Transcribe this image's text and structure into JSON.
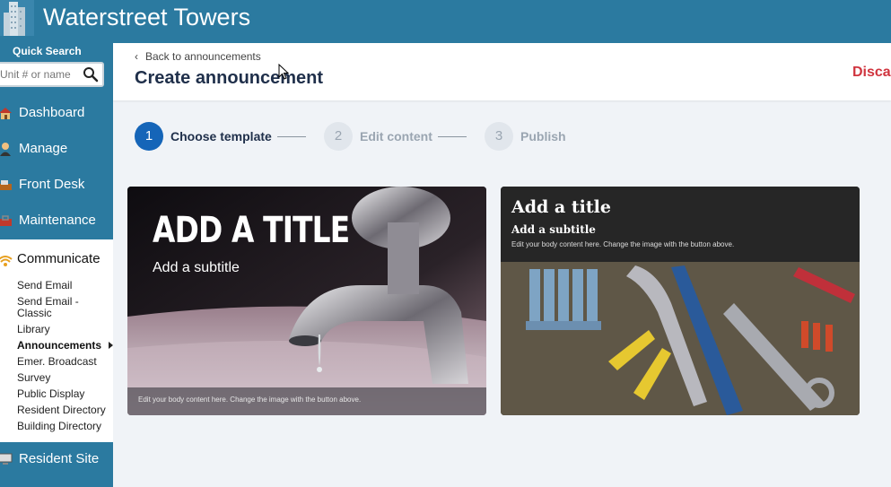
{
  "app": {
    "title": "Waterstreet Towers"
  },
  "sidebar": {
    "quick_search_label": "Quick Search",
    "quick_search_placeholder": "Unit # or name",
    "items": [
      {
        "label": "Dashboard",
        "icon": "house-icon"
      },
      {
        "label": "Manage",
        "icon": "person-icon"
      },
      {
        "label": "Front Desk",
        "icon": "desk-icon"
      },
      {
        "label": "Maintenance",
        "icon": "toolbox-icon"
      }
    ],
    "communicate": {
      "label": "Communicate",
      "icon": "wifi-icon",
      "subitems": [
        {
          "label": "Send Email"
        },
        {
          "label": "Send Email - Classic"
        },
        {
          "label": "Library"
        },
        {
          "label": "Announcements",
          "active": true
        },
        {
          "label": "Emer. Broadcast"
        },
        {
          "label": "Survey"
        },
        {
          "label": "Public Display"
        },
        {
          "label": "Resident Directory"
        },
        {
          "label": "Building Directory"
        }
      ]
    },
    "resident_site": {
      "label": "Resident Site",
      "icon": "monitor-icon"
    }
  },
  "header": {
    "back_label": "Back to announcements",
    "page_title": "Create announcement",
    "discard_label": "Discar"
  },
  "stepper": [
    {
      "num": "1",
      "label": "Choose template",
      "state": "active"
    },
    {
      "num": "2",
      "label": "Edit content",
      "state": "inactive"
    },
    {
      "num": "3",
      "label": "Publish",
      "state": "inactive"
    }
  ],
  "templates": [
    {
      "title": "ADD A TITLE",
      "subtitle": "Add a subtitle",
      "body": "Edit your body content here. Change the image with the button above.",
      "image": "faucet-water-drop"
    },
    {
      "title": "Add a title",
      "subtitle": "Add a subtitle",
      "body": "Edit your body content here. Change the image with the button above.",
      "image": "tools-on-wood"
    }
  ],
  "colors": {
    "brand": "#2b7aa0",
    "step_active": "#1565b8",
    "discard": "#d0353f"
  }
}
